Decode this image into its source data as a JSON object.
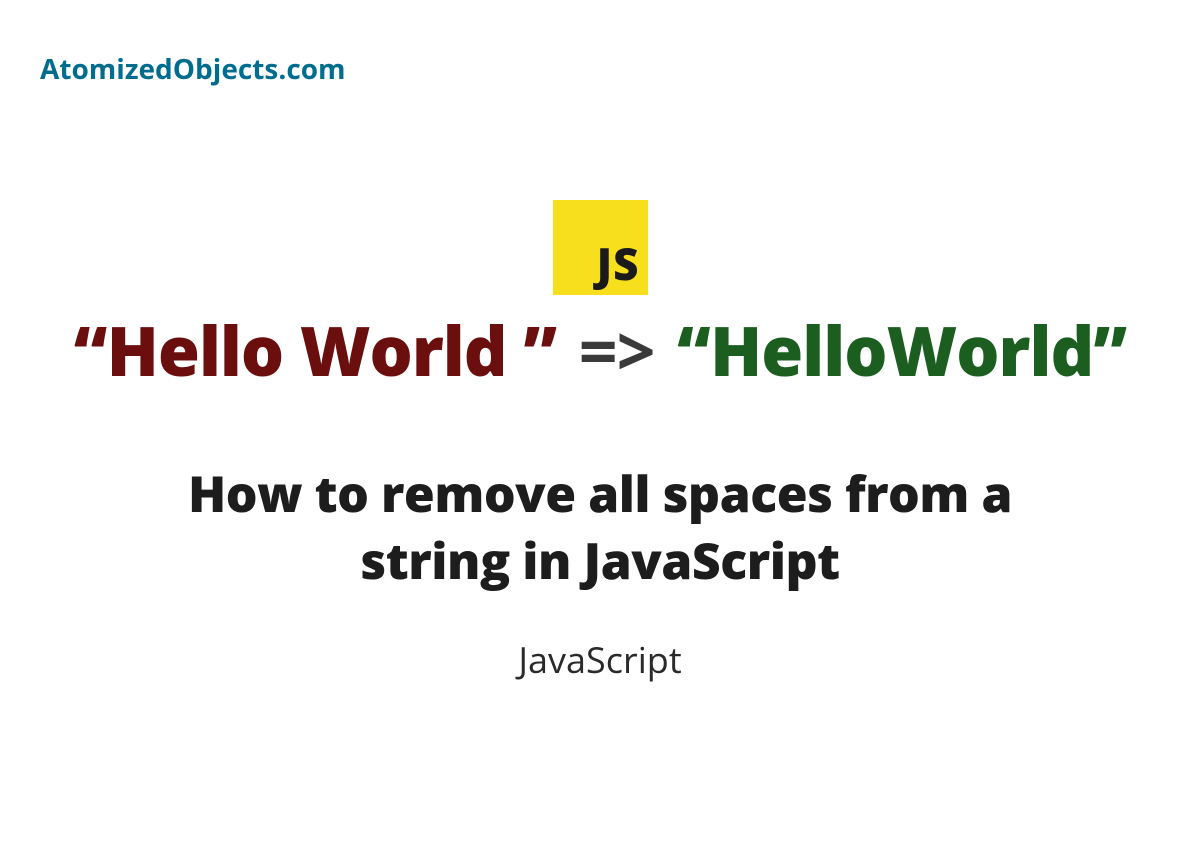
{
  "site": {
    "name": "AtomizedObjects.com"
  },
  "jsLogo": {
    "label": "JS"
  },
  "transform": {
    "before": "“Hello World ”",
    "arrow": "=>",
    "after": "“HelloWorld”"
  },
  "article": {
    "title": "How to remove all spaces from a string in JavaScript",
    "category": "JavaScript"
  }
}
